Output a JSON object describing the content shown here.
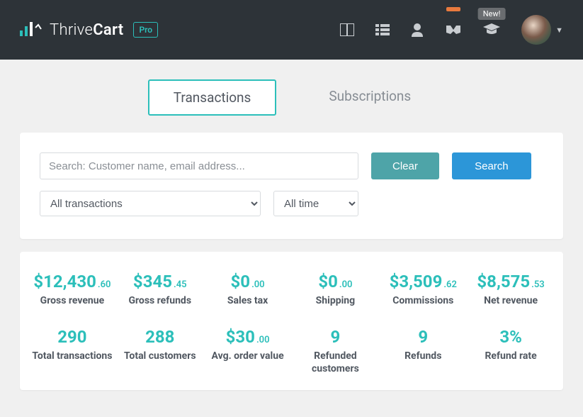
{
  "header": {
    "brand_part1": "Thrive",
    "brand_part2": "Cart",
    "pro_label": "Pro",
    "new_badge": "New!"
  },
  "tabs": {
    "transactions": "Transactions",
    "subscriptions": "Subscriptions"
  },
  "filters": {
    "search_placeholder": "Search: Customer name, email address...",
    "clear": "Clear",
    "search": "Search",
    "type_selected": "All transactions",
    "time_selected": "All time"
  },
  "stats": {
    "gross_revenue": {
      "main": "$12,430",
      "cents": ".60",
      "label": "Gross revenue"
    },
    "gross_refunds": {
      "main": "$345",
      "cents": ".45",
      "label": "Gross refunds"
    },
    "sales_tax": {
      "main": "$0",
      "cents": ".00",
      "label": "Sales tax"
    },
    "shipping": {
      "main": "$0",
      "cents": ".00",
      "label": "Shipping"
    },
    "commissions": {
      "main": "$3,509",
      "cents": ".62",
      "label": "Commissions"
    },
    "net_revenue": {
      "main": "$8,575",
      "cents": ".53",
      "label": "Net revenue"
    },
    "total_txn": {
      "main": "290",
      "cents": "",
      "label": "Total transactions"
    },
    "total_cust": {
      "main": "288",
      "cents": "",
      "label": "Total customers"
    },
    "avg_order": {
      "main": "$30",
      "cents": ".00",
      "label": "Avg. order value"
    },
    "refunded_cust": {
      "main": "9",
      "cents": "",
      "label": "Refunded customers"
    },
    "refunds": {
      "main": "9",
      "cents": "",
      "label": "Refunds"
    },
    "refund_rate": {
      "main": "3%",
      "cents": "",
      "label": "Refund rate"
    }
  }
}
